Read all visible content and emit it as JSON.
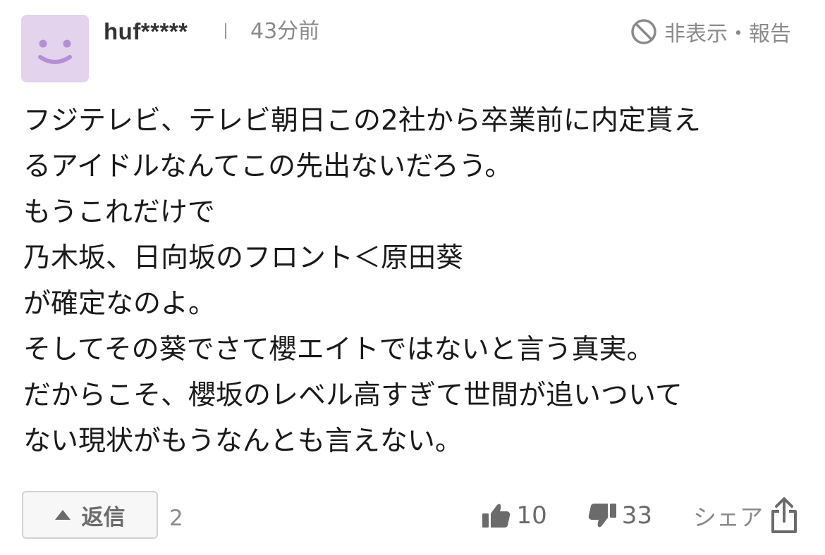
{
  "comment": {
    "author": "huf*****",
    "posted_ago": "43分前",
    "hide_report_label": "非表示・報告",
    "body": "フジテレビ、テレビ朝日この2社から卒業前に内定貰え\nるアイドルなんてこの先出ないだろう。\nもうこれだけで\n乃木坂、日向坂のフロント＜原田葵\nが確定なのよ。\nそしてその葵でさて櫻エイトではないと言う真実。\nだからこそ、櫻坂のレベル高すぎて世間が追いついて\nない現状がもうなんとも言えない。"
  },
  "reply": {
    "label": "返信",
    "count": "2"
  },
  "reactions": {
    "like_count": "10",
    "dislike_count": "33",
    "share_label": "シェア"
  },
  "icons": {
    "avatar": "smiley-avatar-icon",
    "hide": "prohibit-icon",
    "reply": "triangle-up-icon",
    "like": "thumbs-up-icon",
    "dislike": "thumbs-down-icon",
    "share": "share-icon"
  },
  "colors": {
    "avatar_bg": "#e4d3ec",
    "avatar_face": "#b48fd6",
    "muted_text": "#8a8a8a",
    "icon_gray": "#6b6b6b"
  }
}
